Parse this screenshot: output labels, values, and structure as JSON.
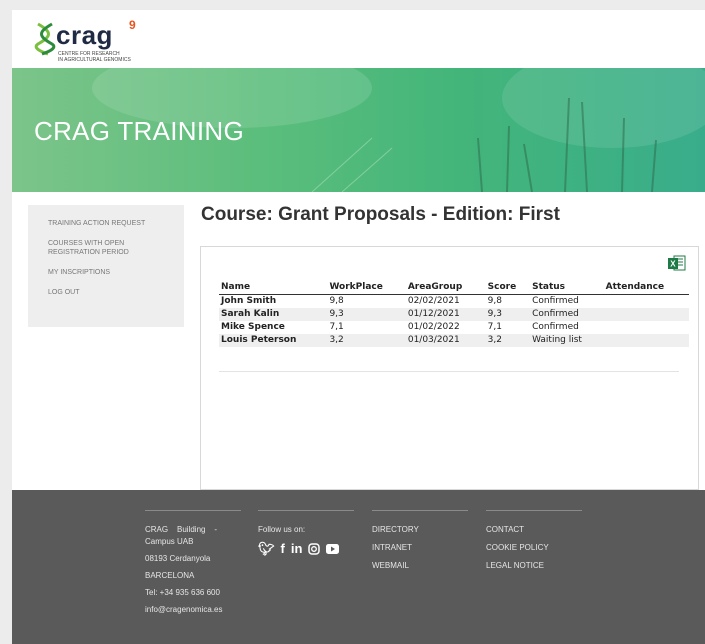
{
  "brand": {
    "logo_word": "crag",
    "logo_sup": "9",
    "logo_sub_line1": "CENTRE FOR RESEARCH",
    "logo_sub_line2": "IN AGRICULTURAL GENOMICS",
    "banner_title": "CRAG TRAINING"
  },
  "sidebar": {
    "items": [
      {
        "label": "TRAINING ACTION REQUEST"
      },
      {
        "label": "COURSES WITH OPEN REGISTRATION PERIOD"
      },
      {
        "label": "MY INSCRIPTIONS"
      },
      {
        "label": "LOG OUT"
      }
    ]
  },
  "main": {
    "title": "Course: Grant Proposals - Edition: First",
    "export_icon": "excel-icon",
    "columns": [
      "Name",
      "WorkPlace",
      "AreaGroup",
      "Score",
      "Status",
      "Attendance"
    ],
    "rows": [
      {
        "name": "John Smith",
        "workplace": "9,8",
        "areagroup": "02/02/2021",
        "score": "9,8",
        "status": "Confirmed",
        "attendance": ""
      },
      {
        "name": "Sarah Kalin",
        "workplace": "9,3",
        "areagroup": "01/12/2021",
        "score": "9,3",
        "status": "Confirmed",
        "attendance": ""
      },
      {
        "name": "Mike Spence",
        "workplace": "7,1",
        "areagroup": "01/02/2022",
        "score": "7,1",
        "status": "Confirmed",
        "attendance": ""
      },
      {
        "name": "Louis Peterson",
        "workplace": "3,2",
        "areagroup": "01/03/2021",
        "score": "3,2",
        "status": "Waiting list",
        "attendance": ""
      }
    ]
  },
  "footer": {
    "address": {
      "line1": "CRAG    Building    -",
      "line2": "Campus UAB",
      "line3": "08193 Cerdanyola",
      "line4": "BARCELONA",
      "line5": "Tel: +34 935 636 600",
      "line6": "info@cragenomica.es"
    },
    "follow_label": "Follow us on:",
    "social": [
      "twitter-icon",
      "facebook-icon",
      "linkedin-icon",
      "instagram-icon",
      "youtube-icon"
    ],
    "links1": [
      "DIRECTORY",
      "INTRANET",
      "WEBMAIL"
    ],
    "links2": [
      "CONTACT",
      "COOKIE POLICY",
      "LEGAL NOTICE"
    ]
  },
  "colors": {
    "banner": "#43b57a",
    "footer": "#5a5a5a",
    "accent_orange": "#e8541c",
    "logo_navy": "#1f2a44",
    "excel_green": "#1e7b45"
  }
}
